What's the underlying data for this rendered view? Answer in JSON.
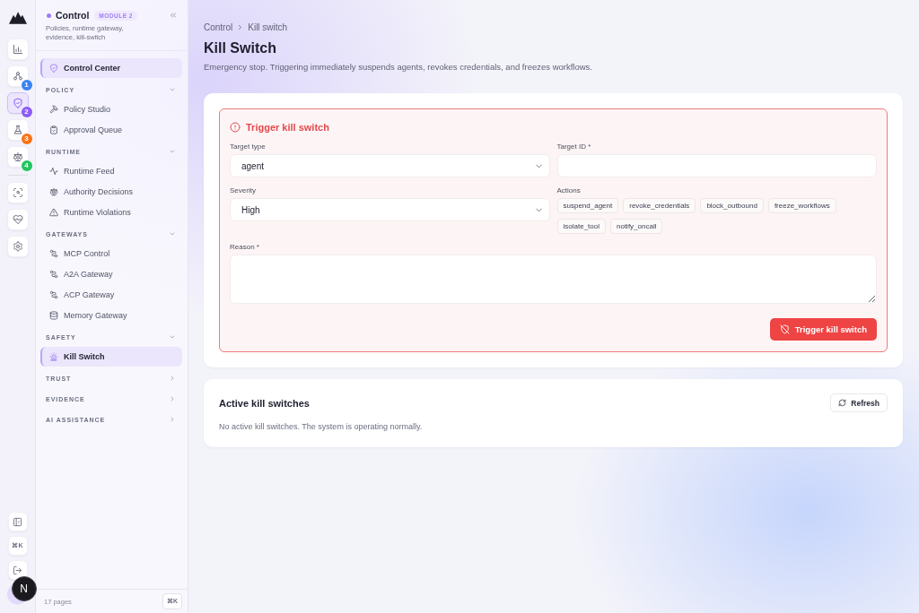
{
  "rail": {
    "primary": [
      {
        "selected": false
      },
      {
        "badge": "1",
        "color": "#3b82f6",
        "selected": false
      },
      {
        "badge": "2",
        "color": "#8b5cf6",
        "selected": true
      },
      {
        "badge": "3",
        "color": "#f97316",
        "selected": false
      },
      {
        "badge": "4",
        "color": "#22c55e",
        "selected": false
      }
    ],
    "secondary": [
      {
        "selected": false
      },
      {
        "selected": false
      },
      {
        "selected": false
      }
    ],
    "shortcut": "⌘K",
    "dev_indicator": "N"
  },
  "sidebar": {
    "module": {
      "name": "Control",
      "badge": "MODULE 2",
      "description": "Policies, runtime gateway, evidence, kill-switch"
    },
    "home": {
      "label": "Control Center",
      "selected": true
    },
    "sections": [
      {
        "title": "POLICY",
        "expanded": true,
        "items": [
          {
            "label": "Policy Studio",
            "selected": false
          },
          {
            "label": "Approval Queue",
            "selected": false
          }
        ]
      },
      {
        "title": "RUNTIME",
        "expanded": true,
        "items": [
          {
            "label": "Runtime Feed",
            "selected": false
          },
          {
            "label": "Authority Decisions",
            "selected": false
          },
          {
            "label": "Runtime Violations",
            "selected": false
          }
        ]
      },
      {
        "title": "GATEWAYS",
        "expanded": true,
        "items": [
          {
            "label": "MCP Control",
            "selected": false
          },
          {
            "label": "A2A Gateway",
            "selected": false
          },
          {
            "label": "ACP Gateway",
            "selected": false
          },
          {
            "label": "Memory Gateway",
            "selected": false
          }
        ]
      },
      {
        "title": "SAFETY",
        "expanded": true,
        "items": [
          {
            "label": "Kill Switch",
            "selected": true
          }
        ]
      },
      {
        "title": "TRUST",
        "expanded": false
      },
      {
        "title": "EVIDENCE",
        "expanded": false
      },
      {
        "title": "AI ASSISTANCE",
        "expanded": false
      }
    ],
    "footer": {
      "page_count": "17 pages",
      "shortcut": "⌘K"
    }
  },
  "breadcrumb": [
    "Control",
    "Kill switch"
  ],
  "title": "Kill Switch",
  "subtitle": "Emergency stop. Triggering immediately suspends agents, revokes credentials, and freezes workflows.",
  "trigger_form": {
    "title": "Trigger kill switch",
    "target_type": {
      "label": "Target type",
      "value": "agent"
    },
    "target_id": {
      "label": "Target ID *"
    },
    "severity": {
      "label": "Severity",
      "value": "High"
    },
    "actions": {
      "label": "Actions",
      "options": [
        {
          "label": "suspend_agent",
          "selected": false
        },
        {
          "label": "revoke_credentials",
          "selected": false
        },
        {
          "label": "block_outbound",
          "selected": false
        },
        {
          "label": "freeze_workflows",
          "selected": false
        },
        {
          "label": "isolate_tool",
          "selected": false
        },
        {
          "label": "notify_oncall",
          "selected": false
        }
      ]
    },
    "reason": {
      "label": "Reason *"
    },
    "submit": "Trigger kill switch"
  },
  "active_kill_switches": {
    "title": "Active kill switches",
    "refresh": "Refresh",
    "empty_text": "No active kill switches. The system is operating normally."
  }
}
